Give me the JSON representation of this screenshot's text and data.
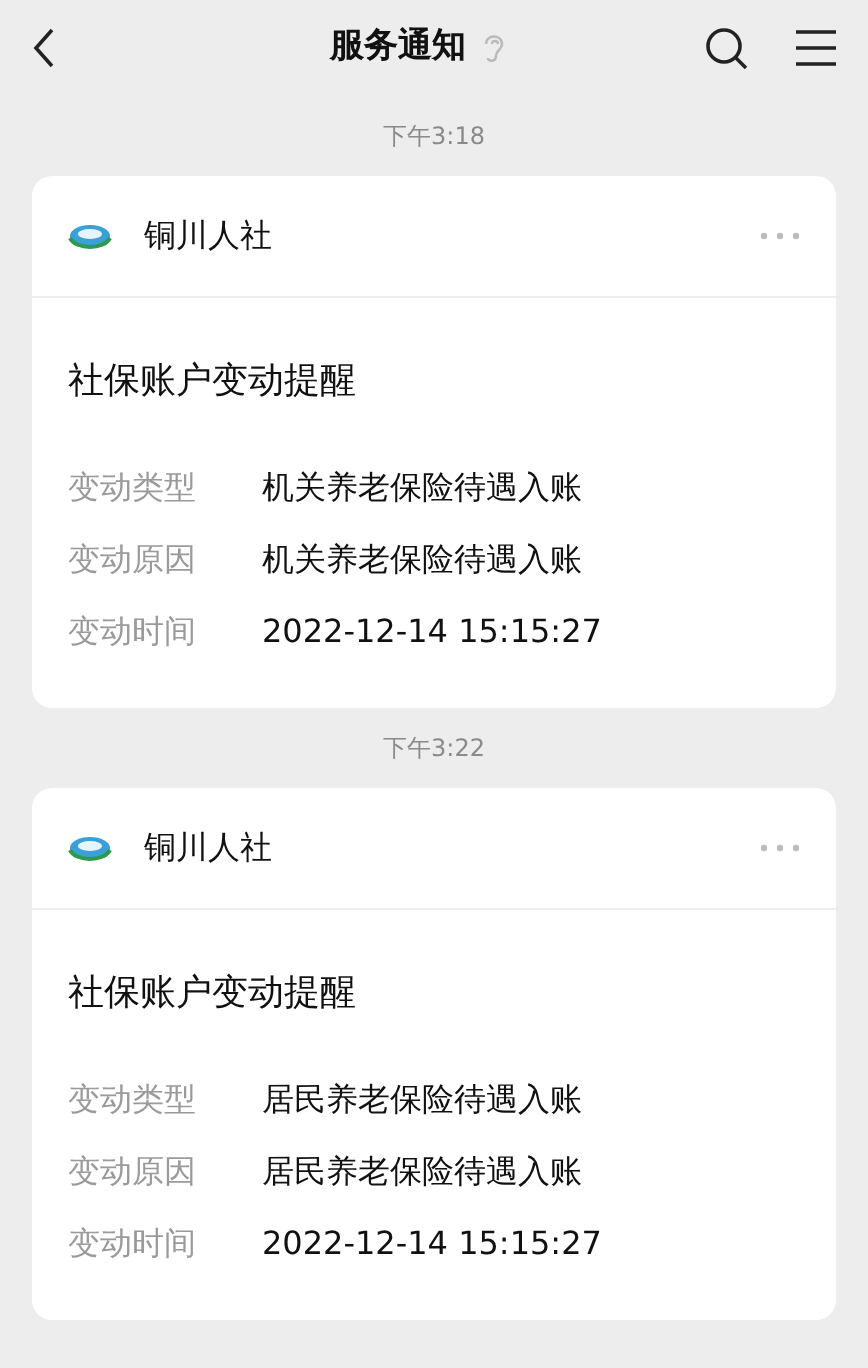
{
  "header": {
    "title": "服务通知"
  },
  "messages": [
    {
      "time": "下午3:18",
      "sender": "铜川人社",
      "title": "社保账户变动提醒",
      "fields": [
        {
          "label": "变动类型",
          "value": "机关养老保险待遇入账"
        },
        {
          "label": "变动原因",
          "value": "机关养老保险待遇入账"
        },
        {
          "label": "变动时间",
          "value": "2022-12-14 15:15:27"
        }
      ]
    },
    {
      "time": "下午3:22",
      "sender": "铜川人社",
      "title": "社保账户变动提醒",
      "fields": [
        {
          "label": "变动类型",
          "value": "居民养老保险待遇入账"
        },
        {
          "label": "变动原因",
          "value": "居民养老保险待遇入账"
        },
        {
          "label": "变动时间",
          "value": "2022-12-14 15:15:27"
        }
      ]
    }
  ]
}
